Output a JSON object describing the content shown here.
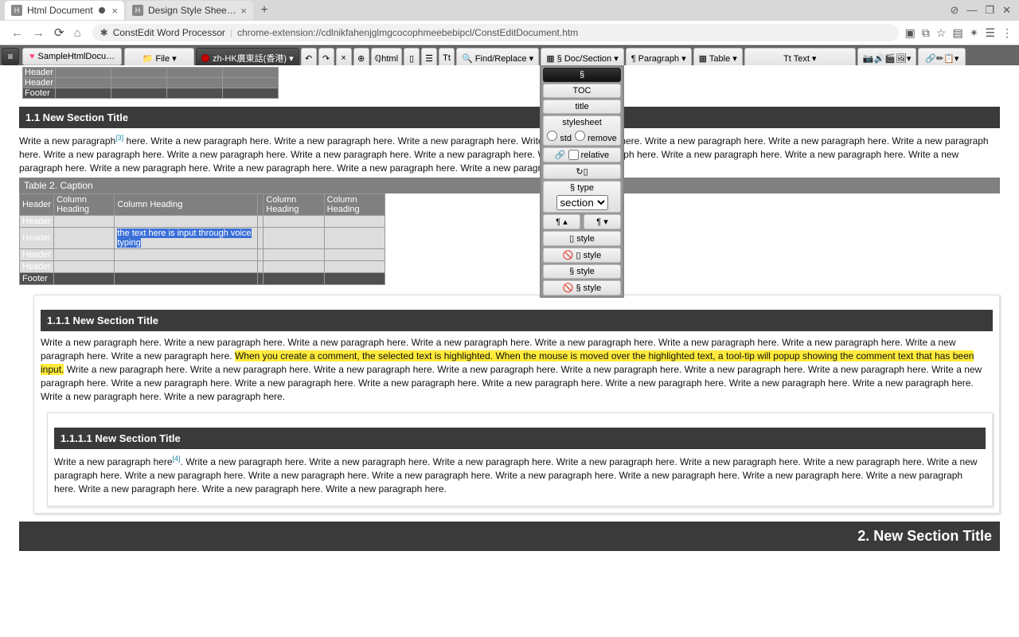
{
  "browser": {
    "tabs": [
      {
        "title": "Html Document",
        "modified": true
      },
      {
        "title": "Design Style Sheet For Ht…",
        "modified": false
      }
    ],
    "window": {
      "close": "✕",
      "min": "—",
      "max": "❐",
      "info": "⊘"
    },
    "nav": {
      "back": "←",
      "forward": "→",
      "reload": "⟳",
      "home": "⌂"
    },
    "url_host": "ConstEdit Word Processor",
    "url_rest": "chrome-extension://cdlnikfahenjglmgcocophmeebebipcl/ConstEditDocument.htm",
    "right_icons": [
      "▣",
      "⧉",
      "☆",
      "▤",
      "✴",
      "☰",
      "⋮"
    ]
  },
  "toolbar": {
    "menu": "≡",
    "doc_title": "SampleHtmlDocu…",
    "file": "📁 File ▾",
    "language": "zh-HK廣東話(香港) ▾",
    "undo": "↶",
    "redo": "↷",
    "cut": "✂",
    "html_x": "×",
    "qhtml": "ℚhtml",
    "book": "▯",
    "pagebreak": "☰",
    "tt_small": "Tt",
    "find": "🔍 Find/Replace ▾",
    "docsection": "▦ § Doc/Section ▾",
    "paragraph": "¶ Paragraph ▾",
    "table": "▦ Table ▾",
    "tt_text": "Tt Text ▾",
    "media": [
      "📷",
      "🔊",
      "🎬",
      "🖼",
      "▾"
    ],
    "link": [
      "🔗",
      "✏",
      "📋",
      "▾"
    ]
  },
  "dropdown": {
    "items": {
      "section_sym": "§",
      "toc": "TOC",
      "title": "title",
      "stylesheet": "stylesheet",
      "std": "std",
      "remove": "remove",
      "relative": "relative",
      "refresh_icons": "↻▯",
      "type_label": "§ type",
      "type_value": "section",
      "para_up": "¶ ▴",
      "para_down": "¶ ▾",
      "book_style": "▯ style",
      "no_book_style": "🚫 ▯ style",
      "s_style": "§ style",
      "no_s_style": "🚫 § style"
    }
  },
  "document": {
    "top_table": {
      "rows": [
        {
          "type": "hdr",
          "label": "Header"
        },
        {
          "type": "hdr",
          "label": "Header"
        },
        {
          "type": "ftr",
          "label": "Footer"
        }
      ],
      "cols": 5
    },
    "s11_title": "1.1 New Section Title",
    "para1_pre": "Write a new paragraph",
    "para1_sup": "[3]",
    "para1_post": " here. Write a new paragraph here. Write a new paragraph here. Write a new paragraph here. Write a new paragraph here. Write a new paragraph here. Write a new paragraph here. Write a new paragraph here. Write a new paragraph here. Write a new paragraph here. Write a new paragraph here. Write a new paragraph here. Write a new paragraph here. Write a new paragraph here. Write a new paragraph here. Write a new paragraph here. Write a new paragraph here. Write a new paragraph here. Write a new paragraph here. Write a new paragraph here.",
    "table2": {
      "caption": "Table 2. Caption",
      "headers": [
        "Header",
        "Column Heading",
        "Column Heading",
        "",
        "Column Heading",
        "Column Heading"
      ],
      "body_labels": [
        "Header",
        "Header",
        "Header",
        "Header"
      ],
      "voice_text": "the text here is input through voice typing",
      "footer": "Footer"
    },
    "s111_title": "1.1.1 New Section Title",
    "para2_pre": "Write a new paragraph here. Write a new paragraph here. Write a new paragraph here. Write a new paragraph here. Write a new paragraph here. Write a new paragraph here. Write a new paragraph here. Write a new paragraph here. Write a new paragraph here. ",
    "para2_hl": "When you create a comment, the selected text is highlighted. When the mouse is moved over the highlighted text, a tool-tip will popup showing the comment text that has been input.",
    "para2_post": " Write a new paragraph here. Write a new paragraph here. Write a new paragraph here. Write a new paragraph here. Write a new paragraph here. Write a new paragraph here. Write a new paragraph here. Write a new paragraph here. Write a new paragraph here. Write a new paragraph here. Write a new paragraph here. Write a new paragraph here. Write a new paragraph here. Write a new paragraph here. Write a new paragraph here. Write a new paragraph here. Write a new paragraph here.",
    "s1111_title": "1.1.1.1 New Section Title",
    "para3_pre": "Write a new paragraph here",
    "para3_sup": "[4]",
    "para3_post": ". Write a new paragraph here. Write a new paragraph here. Write a new paragraph here. Write a new paragraph here. Write a new paragraph here. Write a new paragraph here. Write a new paragraph here. Write a new paragraph here. Write a new paragraph here. Write a new paragraph here. Write a new paragraph here. Write a new paragraph here. Write a new paragraph here. Write a new paragraph here. Write a new paragraph here. Write a new paragraph here. Write a new paragraph here.",
    "s2_title": "2. New Section Title"
  }
}
